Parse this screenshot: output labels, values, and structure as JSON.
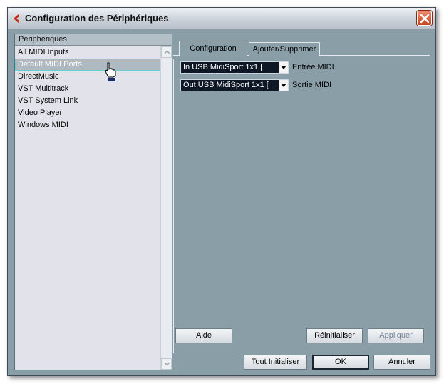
{
  "window": {
    "title": "Configuration des Périphériques"
  },
  "devices": {
    "header": "Périphériques",
    "items": [
      {
        "label": "All MIDI Inputs",
        "selected": false
      },
      {
        "label": "Default MIDI Ports",
        "selected": true
      },
      {
        "label": "DirectMusic",
        "selected": false
      },
      {
        "label": "VST Multitrack",
        "selected": false
      },
      {
        "label": "VST System Link",
        "selected": false
      },
      {
        "label": "Video Player",
        "selected": false
      },
      {
        "label": "Windows MIDI",
        "selected": false
      }
    ]
  },
  "tabs": [
    {
      "label": "Configuration",
      "active": true
    },
    {
      "label": "Ajouter/Supprimer",
      "active": false
    }
  ],
  "config": {
    "midi_in": {
      "value": "In USB MidiSport 1x1 [",
      "label": "Entrée MIDI"
    },
    "midi_out": {
      "value": "Out USB MidiSport 1x1 [",
      "label": "Sortie MIDI"
    }
  },
  "buttons": {
    "help": "Aide",
    "reset": "Réinitialiser",
    "apply": "Appliquer",
    "reset_all": "Tout Initialiser",
    "ok": "OK",
    "cancel": "Annuler"
  },
  "colors": {
    "dialog_bg": "#8a9ea8",
    "list_bg": "#e2e2ea",
    "combo_bg": "#0e1726",
    "close_red": "#c8421e"
  },
  "icons": {
    "app": "cubase-logo-icon",
    "close": "close-icon",
    "cursor": "hand-pointer-icon"
  }
}
